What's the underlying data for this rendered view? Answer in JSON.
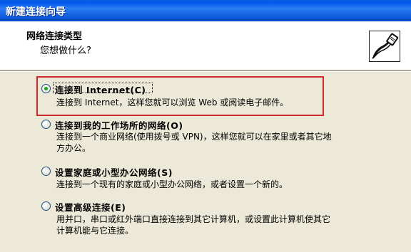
{
  "window": {
    "title": "新建连接向导"
  },
  "header": {
    "title": "网络连接类型",
    "subtitle": "您想做什么?",
    "icon": "network-cable-icon"
  },
  "options": [
    {
      "label": "连接到 Internet(C)",
      "description": [
        "连接到 Internet，这样您就可以浏览 Web 或阅读电子邮件。"
      ],
      "selected": true
    },
    {
      "label": "连接到我的工作场所的网络(O)",
      "description": [
        "连接到一个商业网络(使用拨号或 VPN)，这样您就可以在家里或者其它地",
        "方办公。"
      ],
      "selected": false
    },
    {
      "label": "设置家庭或小型办公网络(S)",
      "description": [
        "连接到一个现有的家庭或小型办公网络，或者设置一个新的。"
      ],
      "selected": false
    },
    {
      "label": "设置高级连接(E)",
      "description": [
        "用并口，串口或红外端口直接连接到其它计算机，或设置此计算机使其它",
        "计算机能与它连接。"
      ],
      "selected": false
    }
  ],
  "colors": {
    "titlebar": "#0058ee",
    "highlight_border": "#d12a2a",
    "radio_selected": "#1aa31a",
    "dialog_bg": "#ece9d8"
  }
}
